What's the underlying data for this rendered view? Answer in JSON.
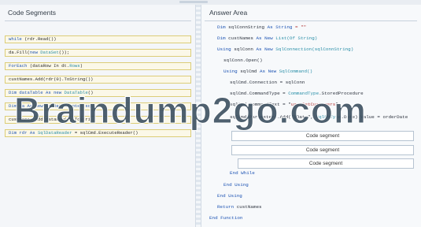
{
  "left_panel": {
    "title": "Code Segments",
    "segments": [
      {
        "p1": "while ",
        "p2": "(rdr.Read())",
        "p3": "",
        "p4": ""
      },
      {
        "p1": "da.Fill(",
        "p2": "new ",
        "p3": "DataSet",
        "p4": "());"
      },
      {
        "p1": "ForEach ",
        "p2": "(dataRow In dt.",
        "p3": "Rows",
        "p4": ")"
      },
      {
        "p1": "custNames.Add(rdr(0).ToString())",
        "p2": "",
        "p3": "",
        "p4": ""
      },
      {
        "p1": "Dim dataTable As ",
        "p2": "new ",
        "p3": "DataTable",
        "p4": "()"
      },
      {
        "p1": "Dim da As New SqlDataAdapter(sql",
        "p2": "",
        "p3": "",
        "p4": ""
      },
      {
        "p1": "custNames.Add(dataRow(0).ToStri",
        "p2": "",
        "p3": "",
        "p4": ""
      },
      {
        "p1": "Dim rdr As ",
        "p2": "SqlDataReader",
        "p3": " = sqlCmd.ExecuteReader()",
        "p4": ""
      }
    ]
  },
  "right_panel": {
    "title": "Answer Area",
    "lines": [
      {
        "a": "Dim ",
        "b": "sqlConnString ",
        "c": "As String",
        "d": " = \"\""
      },
      {
        "a": "Dim ",
        "b": "custNames ",
        "c": "As New ",
        "d": "List(Of String)"
      },
      {
        "a": "Using ",
        "b": "sqlConn ",
        "c": "As New ",
        "d": "SqlConnection(sqlConnString)"
      },
      {
        "a": "sqlConn.Open()",
        "b": "",
        "c": "",
        "d": ""
      },
      {
        "a": "Using ",
        "b": "sqlCmd ",
        "c": "As New ",
        "d": "SqlCommand()"
      },
      {
        "a": "sqlCmd.Connection = sqlConn",
        "b": "",
        "c": "",
        "d": ""
      },
      {
        "a": "sqlCmd.CommandType = ",
        "b": "CommandType",
        "c": ".StoredProcedure",
        "d": ""
      },
      {
        "a": "sqlCmd.CommandText = \"",
        "b": "usp_GetCustomers",
        "c": "\"",
        "d": ""
      },
      {
        "a": "sqlCmd.Parameters.Add(\"@Date\", ",
        "b": "SqlDbType",
        "c": ".Date).Value = orderDate",
        "d": ""
      },
      {
        "a": "End While",
        "b": "",
        "c": "",
        "d": ""
      },
      {
        "a": "End Using",
        "b": "",
        "c": "",
        "d": ""
      },
      {
        "a": "End Using",
        "b": "",
        "c": "",
        "d": ""
      },
      {
        "a": "Return ",
        "b": "custNames",
        "c": "",
        "d": ""
      },
      {
        "a": "End Function",
        "b": "",
        "c": "",
        "d": ""
      }
    ],
    "slots": [
      "Code segment",
      "Code segment",
      "Code segment"
    ]
  },
  "watermark": {
    "text": "Braindump2go.com",
    "color": "#3b4f5f"
  }
}
